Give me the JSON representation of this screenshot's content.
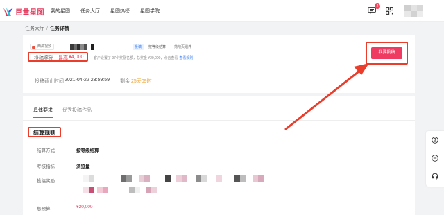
{
  "brand": {
    "logo_text": "巨量星图",
    "accent": "#ef3a62",
    "annotation_color": "#ea3d2b"
  },
  "nav": {
    "items": [
      "我的星图",
      "任务大厅",
      "星图热榜",
      "星图学院"
    ]
  },
  "header": {
    "message_badge": "2"
  },
  "breadcrumb": {
    "parent": "任务大厅",
    "separator": "/",
    "current": "任务详情"
  },
  "task": {
    "source_chip": "西瓜视频",
    "tags": [
      "投稿",
      "按等级结算",
      "落地页组件"
    ],
    "reward_label": "投稿奖励",
    "reward_max_label": "最高",
    "reward_value": "¥4,000",
    "reward_note": "客户设置了 97个奖励名额，总奖金 ¥20,000，点击查看",
    "reward_note_link": "查看规则",
    "deadline_label": "投稿截止时间",
    "deadline_value": "2021-04-22 23:59:59",
    "remain_label": "剩余",
    "remain_value": "25天09时",
    "submit_label": "我要投稿"
  },
  "tabs": [
    "具体要求",
    "优秀投稿作品"
  ],
  "settlement": {
    "title": "结算规则",
    "rows": [
      {
        "label": "结算方式",
        "value": "按等级结算"
      },
      {
        "label": "考核指标",
        "value": "浏览量"
      },
      {
        "label": "投稿奖励",
        "value": ""
      },
      {
        "label": "总预算",
        "value": "¥20,000"
      }
    ]
  }
}
